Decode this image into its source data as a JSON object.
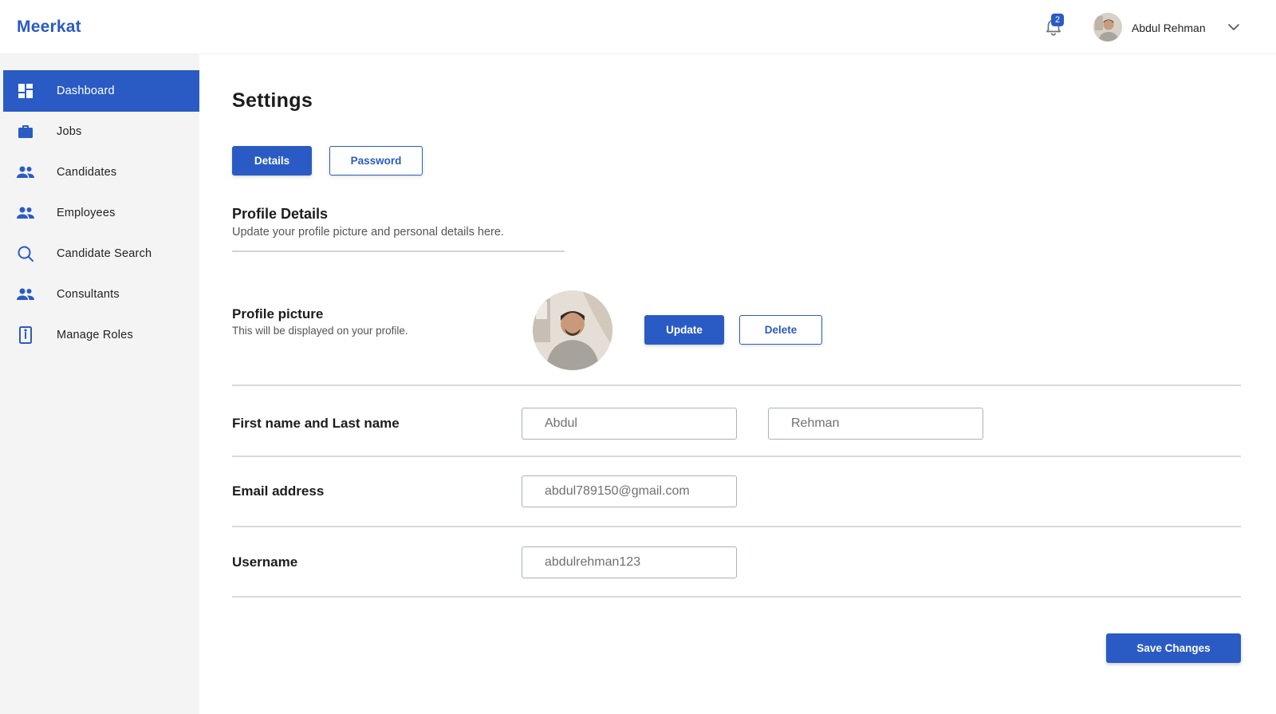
{
  "header": {
    "brand": "Meerkat",
    "notification_count": "2",
    "user_name": "Abdul Rehman"
  },
  "colors": {
    "accent": "#2a5bc4",
    "sidebar_bg": "#f4f4f4"
  },
  "sidebar": {
    "items": [
      {
        "label": "Dashboard",
        "icon": "dashboard-icon",
        "active": true
      },
      {
        "label": "Jobs",
        "icon": "briefcase-icon"
      },
      {
        "label": "Candidates",
        "icon": "people-icon"
      },
      {
        "label": "Employees",
        "icon": "people-icon"
      },
      {
        "label": "Candidate Search",
        "icon": "search-icon"
      },
      {
        "label": "Consultants",
        "icon": "people-icon"
      },
      {
        "label": "Manage Roles",
        "icon": "badge-icon"
      }
    ]
  },
  "main": {
    "title": "Settings",
    "tabs": [
      {
        "label": "Details",
        "active": true
      },
      {
        "label": "Password"
      }
    ],
    "profile_details": {
      "title": "Profile Details",
      "subtitle": "Update your profile picture and personal details here."
    },
    "profile_picture": {
      "label": "Profile picture",
      "subtitle": "This will be displayed on your profile.",
      "update_label": "Update",
      "delete_label": "Delete"
    },
    "name_row": {
      "label": "First name and Last name",
      "first_value": "Abdul",
      "last_value": "Rehman"
    },
    "email_row": {
      "label": "Email address",
      "value": "abdul789150@gmail.com"
    },
    "username_row": {
      "label": "Username",
      "value": "abdulrehman123"
    },
    "save_label": "Save Changes"
  }
}
